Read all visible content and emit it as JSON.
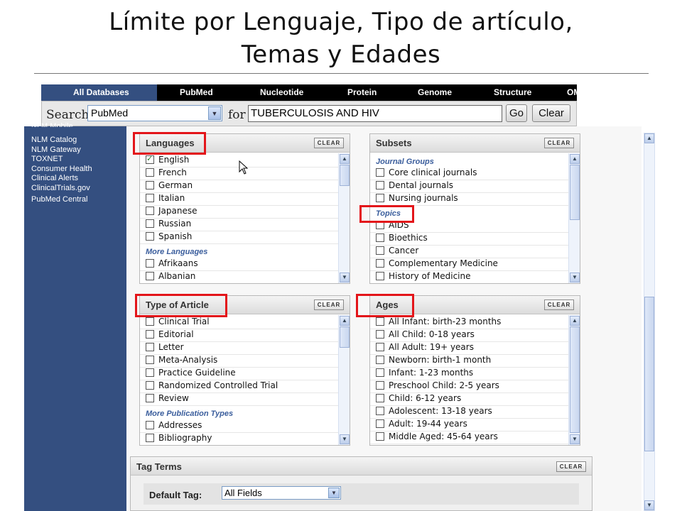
{
  "slide": {
    "title_line1": "Límite por Lenguaje, Tipo de artículo,",
    "title_line2": "Temas y Edades"
  },
  "database_tabs": [
    "All Databases",
    "PubMed",
    "Nucleotide",
    "Protein",
    "Genome",
    "Structure",
    "OM"
  ],
  "search": {
    "search_label": "Search",
    "database": "PubMed",
    "for_label": "for",
    "term": "TUBERCULOSIS AND HIV",
    "go_label": "Go",
    "clear_label": "Clear"
  },
  "sidebar": {
    "items": [
      "NLM Mobile",
      "NLM Catalog",
      "NLM Gateway",
      "TOXNET",
      "Consumer Health",
      "Clinical Alerts",
      "ClinicalTrials.gov",
      "PubMed Central"
    ]
  },
  "panels": {
    "languages": {
      "title": "Languages",
      "clear": "CLEAR",
      "options": [
        "English",
        "French",
        "German",
        "Italian",
        "Japanese",
        "Russian",
        "Spanish"
      ],
      "group": "More Languages",
      "more": [
        "Afrikaans",
        "Albanian"
      ],
      "checked": [
        "English"
      ]
    },
    "subsets": {
      "title": "Subsets",
      "clear": "CLEAR",
      "group1": "Journal Groups",
      "journal_groups": [
        "Core clinical journals",
        "Dental journals",
        "Nursing journals"
      ],
      "group2": "Topics",
      "topics": [
        "AIDS",
        "Bioethics",
        "Cancer",
        "Complementary Medicine",
        "History of Medicine"
      ]
    },
    "type_of_article": {
      "title": "Type of Article",
      "clear": "CLEAR",
      "options": [
        "Clinical Trial",
        "Editorial",
        "Letter",
        "Meta-Analysis",
        "Practice Guideline",
        "Randomized Controlled Trial",
        "Review"
      ],
      "group": "More Publication Types",
      "more": [
        "Addresses",
        "Bibliography"
      ]
    },
    "ages": {
      "title": "Ages",
      "clear": "CLEAR",
      "options": [
        "All Infant: birth-23 months",
        "All Child: 0-18 years",
        "All Adult: 19+ years",
        "Newborn: birth-1 month",
        "Infant: 1-23 months",
        "Preschool Child: 2-5 years",
        "Child: 6-12 years",
        "Adolescent: 13-18 years",
        "Adult: 19-44 years",
        "Middle Aged: 45-64 years"
      ]
    }
  },
  "tag_terms": {
    "title": "Tag Terms",
    "clear": "CLEAR",
    "default_tag_label": "Default Tag:",
    "default_tag_value": "All Fields"
  },
  "colors": {
    "sidebar": "#344f80",
    "highlight": "#e3151a",
    "group_heading": "#3a5d9c"
  }
}
